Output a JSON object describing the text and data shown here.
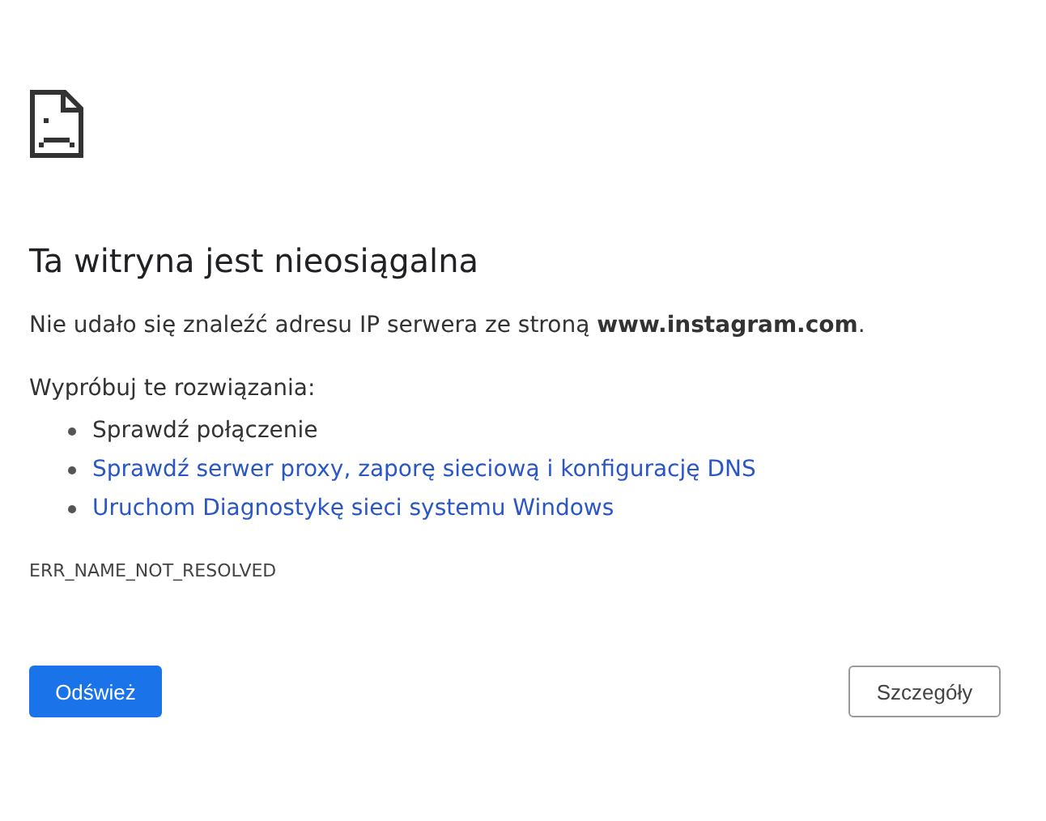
{
  "heading": "Ta witryna jest nieosiągalna",
  "message": "Nie udało się znaleźć adresu IP serwera ze stroną **www.instagram.com**.",
  "suggestions_label": "Wypróbuj te rozwiązania:",
  "suggestions": [
    {
      "kind": "text",
      "text": "Sprawdź połączenie"
    },
    {
      "kind": "link",
      "text": "Sprawdź serwer proxy, zaporę sieciową i konfigurację DNS"
    },
    {
      "kind": "link",
      "text": "Uruchom Diagnostykę sieci systemu Windows"
    }
  ],
  "error_code": "ERR_NAME_NOT_RESOLVED",
  "buttons": [
    {
      "kind": "primary",
      "label": "Odśwież"
    },
    {
      "kind": "secondary",
      "label": "Szczegóły"
    }
  ]
}
